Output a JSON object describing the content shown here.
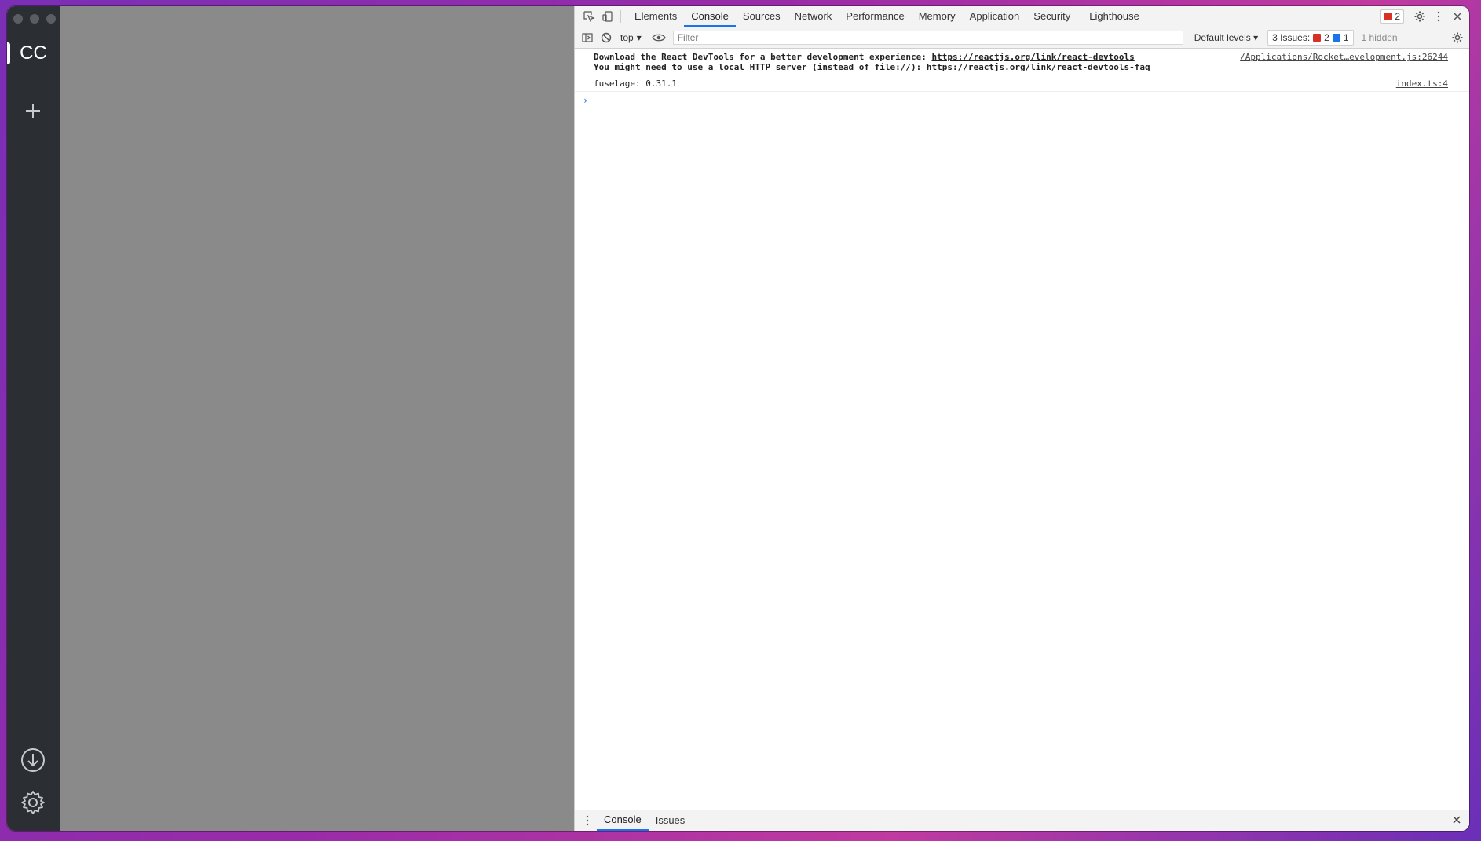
{
  "rail": {
    "server_label": "CC"
  },
  "devtools": {
    "tabs": [
      "Elements",
      "Console",
      "Sources",
      "Network",
      "Performance",
      "Memory",
      "Application",
      "Security",
      "Lighthouse"
    ],
    "active_tab": "Console",
    "error_badge_count": "2",
    "toolbar": {
      "context": "top",
      "filter_placeholder": "Filter",
      "levels": "Default levels",
      "issues_label": "3 Issues:",
      "issues_errors": "2",
      "issues_info": "1",
      "hidden": "1 hidden"
    },
    "messages": [
      {
        "line1_text": "Download the React DevTools for a better development experience: ",
        "line1_link": "https://reactjs.org/link/react-devtools",
        "line2_text": "You might need to use a local HTTP server (instead of file://): ",
        "line2_link": "https://reactjs.org/link/react-devtools-faq",
        "source": "/Applications/Rocket…evelopment.js:26244"
      },
      {
        "text": "fuselage: 0.31.1",
        "source": "index.ts:4"
      }
    ],
    "drawer": {
      "tabs": [
        "Console",
        "Issues"
      ]
    }
  },
  "colors": {
    "rail_bg": "#2b2e33",
    "main_bg": "#8a8a8a",
    "accent": "#1a73e8",
    "error": "#d93025"
  }
}
